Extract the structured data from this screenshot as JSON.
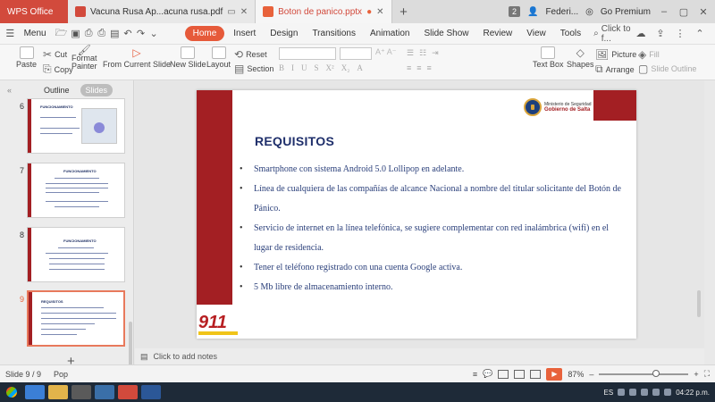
{
  "tabs": {
    "app": "WPS Office",
    "doc1": "Vacuna Rusa Ap...acuna rusa.pdf",
    "doc2": "Boton de panico.pptx",
    "count": "2",
    "user": "Federi...",
    "premium": "Go Premium"
  },
  "menu": {
    "menu_label": "Menu",
    "items": [
      "Home",
      "Insert",
      "Design",
      "Transitions",
      "Animation",
      "Slide Show",
      "Review",
      "View",
      "Tools"
    ],
    "search": "Click to f..."
  },
  "ribbon": {
    "paste": "Paste",
    "cut": "Cut",
    "copy": "Copy",
    "format_painter_1": "Format",
    "format_painter_2": "Painter",
    "from_current": "From Current Slide",
    "new_slide": "New Slide",
    "layout": "Layout",
    "reset": "Reset",
    "section": "Section",
    "text_box": "Text Box",
    "shapes": "Shapes",
    "picture": "Picture",
    "fill": "Fill",
    "arrange": "Arrange",
    "slide_outline": "Slide Outline"
  },
  "pane": {
    "outline": "Outline",
    "slides": "Slides",
    "thumbs": [
      {
        "num": "6",
        "title": "FUNCIONAMIENTO"
      },
      {
        "num": "7",
        "title": "FUNCIONAMIENTO"
      },
      {
        "num": "8",
        "title": "FUNCIONAMIENTO"
      },
      {
        "num": "9",
        "title": "REQUISITOS"
      }
    ]
  },
  "slide": {
    "title": "REQUISITOS",
    "logo_line1": "Ministerio de Seguridad",
    "logo_line2": "Gobierno de Salta",
    "bullets": [
      "Smartphone con sistema Android 5.0 Lollipop en adelante.",
      "Línea de cualquiera de las compañías de alcance Nacional a nombre del titular solicitante del Botón de Pánico.",
      "Servicio de internet en la línea telefónica, se sugiere complementar con red inalámbrica (wifi) en el lugar de residencia.",
      "Tener el teléfono registrado con una cuenta Google activa.",
      "5 Mb libre de almacenamiento interno."
    ],
    "logo911": "911"
  },
  "notes": {
    "placeholder": "Click to add notes"
  },
  "status": {
    "slide_info": "Slide 9 / 9",
    "theme": "Pop",
    "zoom": "87%"
  },
  "taskbar": {
    "lang": "ES",
    "time": "04:22 p.m."
  },
  "colors": {
    "accent": "#e65a3a",
    "slide_red": "#a31f23",
    "title_blue": "#1f2f6b"
  }
}
